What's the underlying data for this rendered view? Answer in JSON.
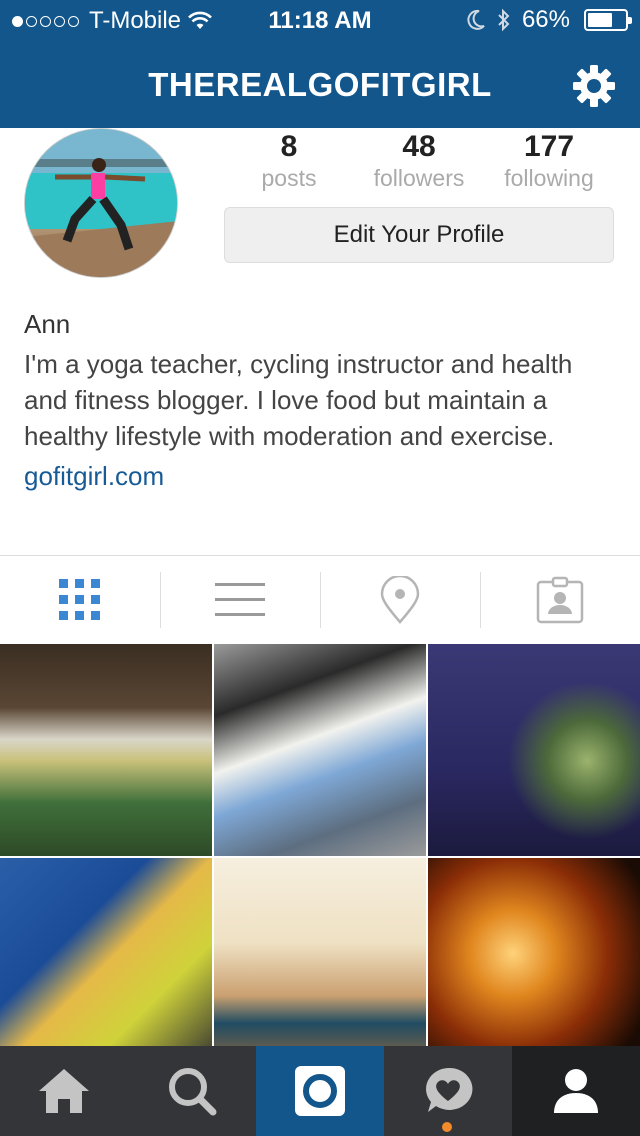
{
  "status_bar": {
    "carrier": "T-Mobile",
    "time": "11:18 AM",
    "battery_text": "66%",
    "battery_level": 0.66,
    "signal_bars_filled": 1,
    "signal_bars_total": 5
  },
  "header": {
    "title": "THEREALGOFITGIRL",
    "background_color": "#12568c"
  },
  "profile": {
    "stats": [
      {
        "value": "8",
        "label": "posts"
      },
      {
        "value": "48",
        "label": "followers"
      },
      {
        "value": "177",
        "label": "following"
      }
    ],
    "edit_button_label": "Edit Your Profile",
    "name": "Ann",
    "bio": "I'm a yoga teacher, cycling instructor and health and fitness blogger. I love food but maintain a healthy lifestyle with moderation and exercise.",
    "website": "gofitgirl.com"
  },
  "view_tabs": [
    {
      "icon": "grid-icon",
      "active": true
    },
    {
      "icon": "list-icon",
      "active": false
    },
    {
      "icon": "location-pin-icon",
      "active": false
    },
    {
      "icon": "tagged-photos-icon",
      "active": false
    }
  ],
  "bottom_nav": [
    {
      "icon": "home-icon"
    },
    {
      "icon": "search-icon"
    },
    {
      "icon": "camera-icon",
      "highlighted": true
    },
    {
      "icon": "activity-heart-icon",
      "has_notification": true
    },
    {
      "icon": "profile-icon",
      "selected": true
    }
  ],
  "colors": {
    "accent_blue": "#12568c",
    "link_blue": "#175b96",
    "active_tab_blue": "#3b87d4",
    "notification_orange": "#f38b2c",
    "nav_background": "#333539"
  }
}
